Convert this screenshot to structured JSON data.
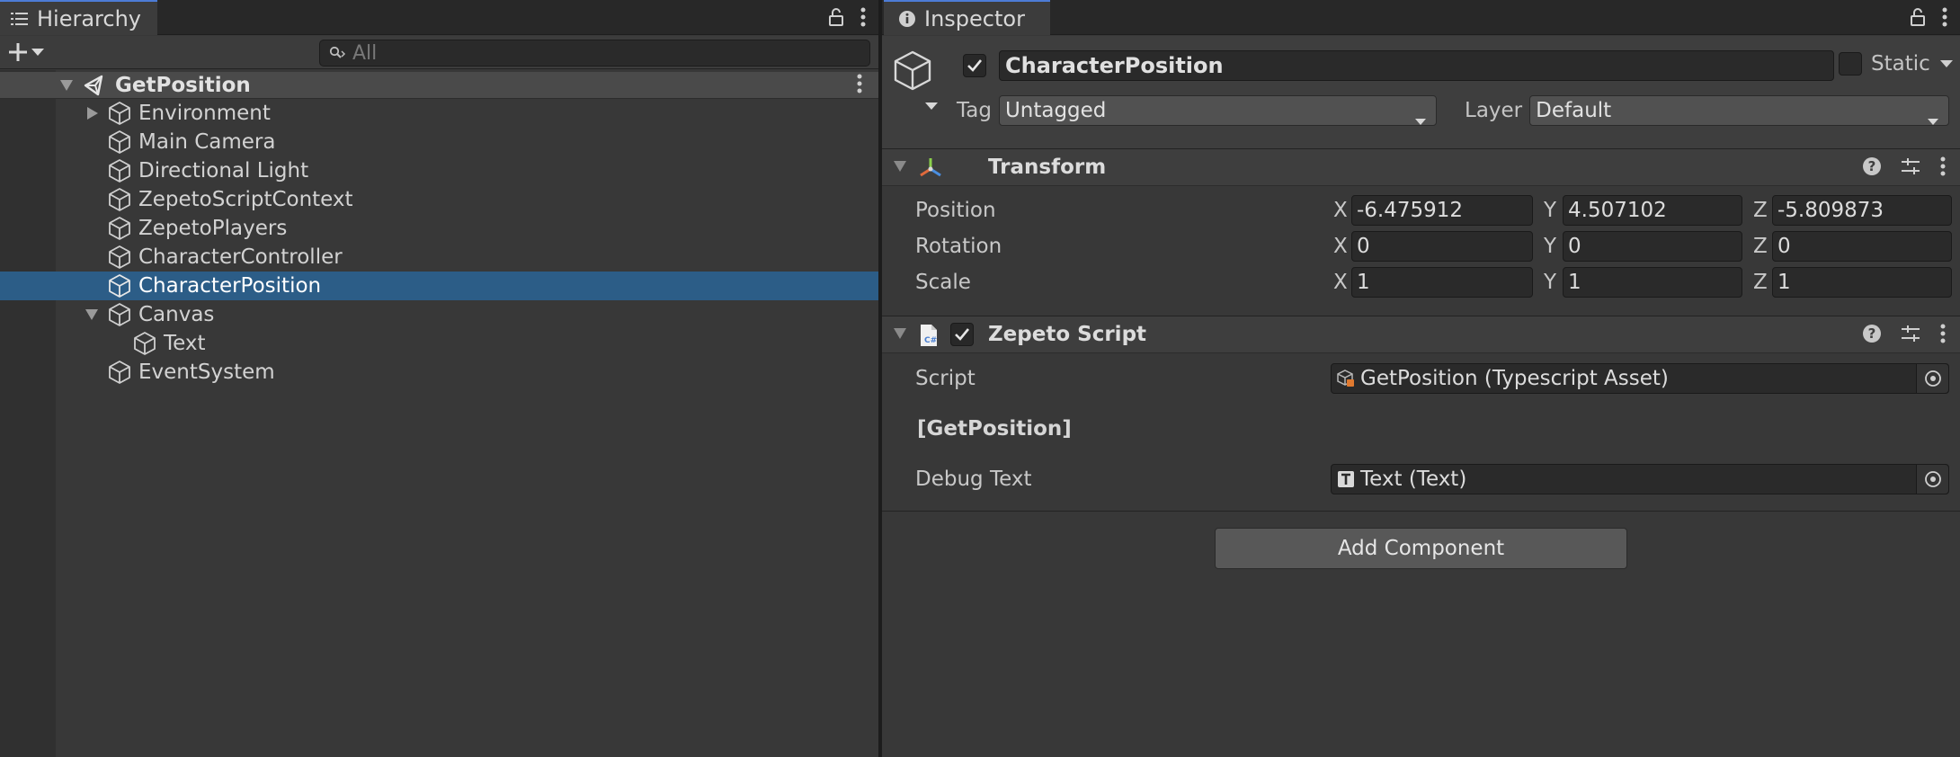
{
  "hierarchy": {
    "tab_label": "Hierarchy",
    "search": {
      "placeholder": "All",
      "value": ""
    },
    "scene": {
      "name": "GetPosition"
    },
    "items": [
      {
        "label": "Environment",
        "depth": 1,
        "expandable": true,
        "expanded": false,
        "selected": false
      },
      {
        "label": "Main Camera",
        "depth": 1,
        "expandable": false,
        "selected": false
      },
      {
        "label": "Directional Light",
        "depth": 1,
        "expandable": false,
        "selected": false
      },
      {
        "label": "ZepetoScriptContext",
        "depth": 1,
        "expandable": false,
        "selected": false
      },
      {
        "label": "ZepetoPlayers",
        "depth": 1,
        "expandable": false,
        "selected": false
      },
      {
        "label": "CharacterController",
        "depth": 1,
        "expandable": false,
        "selected": false
      },
      {
        "label": "CharacterPosition",
        "depth": 1,
        "expandable": false,
        "selected": true
      },
      {
        "label": "Canvas",
        "depth": 1,
        "expandable": true,
        "expanded": true,
        "selected": false
      },
      {
        "label": "Text",
        "depth": 2,
        "expandable": false,
        "selected": false
      },
      {
        "label": "EventSystem",
        "depth": 1,
        "expandable": false,
        "selected": false
      }
    ]
  },
  "inspector": {
    "tab_label": "Inspector",
    "object": {
      "active": true,
      "name": "CharacterPosition",
      "static_label": "Static",
      "static": false,
      "tag_label": "Tag",
      "tag_value": "Untagged",
      "layer_label": "Layer",
      "layer_value": "Default"
    },
    "transform": {
      "title": "Transform",
      "rows": [
        {
          "label": "Position",
          "x": "-6.475912",
          "y": "4.507102",
          "z": "-5.809873"
        },
        {
          "label": "Rotation",
          "x": "0",
          "y": "0",
          "z": "0"
        },
        {
          "label": "Scale",
          "x": "1",
          "y": "1",
          "z": "1"
        }
      ],
      "axis_x": "X",
      "axis_y": "Y",
      "axis_z": "Z"
    },
    "zepeto_script": {
      "title": "Zepeto Script",
      "enabled": true,
      "script_label": "Script",
      "script_value": "GetPosition (Typescript Asset)",
      "section_label": "[GetPosition]",
      "debug_label": "Debug Text",
      "debug_value": "Text (Text)"
    },
    "add_component_label": "Add Component"
  },
  "colors": {
    "panel_bg": "#383838",
    "selection": "#2c5d87",
    "tab_accent": "#4d7cd6"
  }
}
